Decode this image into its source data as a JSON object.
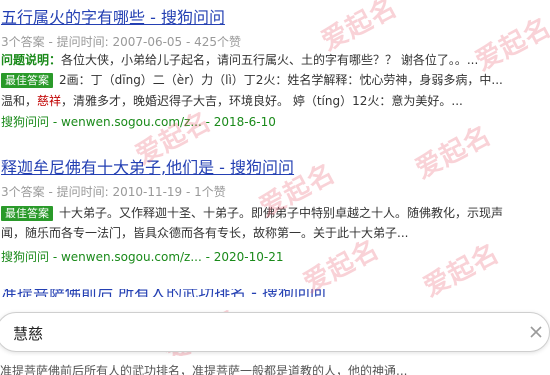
{
  "results": [
    {
      "title": "五行属火的字有哪些 - 搜狗问问",
      "meta": "3个答案 - 提问时间: 2007-06-05 - 425个赞",
      "question_label": "问题说明：",
      "question_text": "各位大侠，小弟给儿子起名，请问五行属火、土的字有哪些？？ 谢各位了。。...",
      "best_label": "最佳答案",
      "answer_line1": "2画：丁（dīng）二（èr）力（lì）丁2火：姓名学解释：忱心劳神，身弱多病，中...",
      "answer_line2_pre": "温和，",
      "answer_line2_hl": "慈祥",
      "answer_line2_post": "，清雅多才，晚婚迟得子大吉，环境良好。 婷（tíng）12火：意为美好。...",
      "source": "搜狗问问",
      "url_date": "wenwen.sogou.com/z... - 2018-6-10"
    },
    {
      "title": "释迦牟尼佛有十大弟子,他们是 - 搜狗问问",
      "meta": "3个答案 - 提问时间: 2010-11-19 - 1个赞",
      "best_label": "最佳答案",
      "answer_line1": "十大弟子。又作释迦十圣、十弟子。即佛弟子中特别卓越之十人。随佛教化，示现声",
      "answer_line2": "闻，随乐而各专一法门，皆具众德而各有专长，故称第一。关于此十大弟子...",
      "source": "搜狗问问",
      "url_date": "wenwen.sogou.com/z... - 2020-10-21"
    }
  ],
  "clipped_title": "准提菩萨佛前后 所有人的武功排名 - 搜狗问问",
  "search": {
    "value": "慧慈"
  },
  "bottom_text": "准提菩萨佛前后所有人的武功排名，准提菩萨一般都是道教的人，他的神通...",
  "watermark": "爱起名",
  "colors": {
    "title_link": "#2440b3",
    "source_green": "#1a8a1a",
    "badge_green": "#2a9a2a",
    "highlight_red": "#c00000",
    "watermark_pink": "#e85c6e"
  },
  "icons": {
    "clear": "close-icon"
  }
}
